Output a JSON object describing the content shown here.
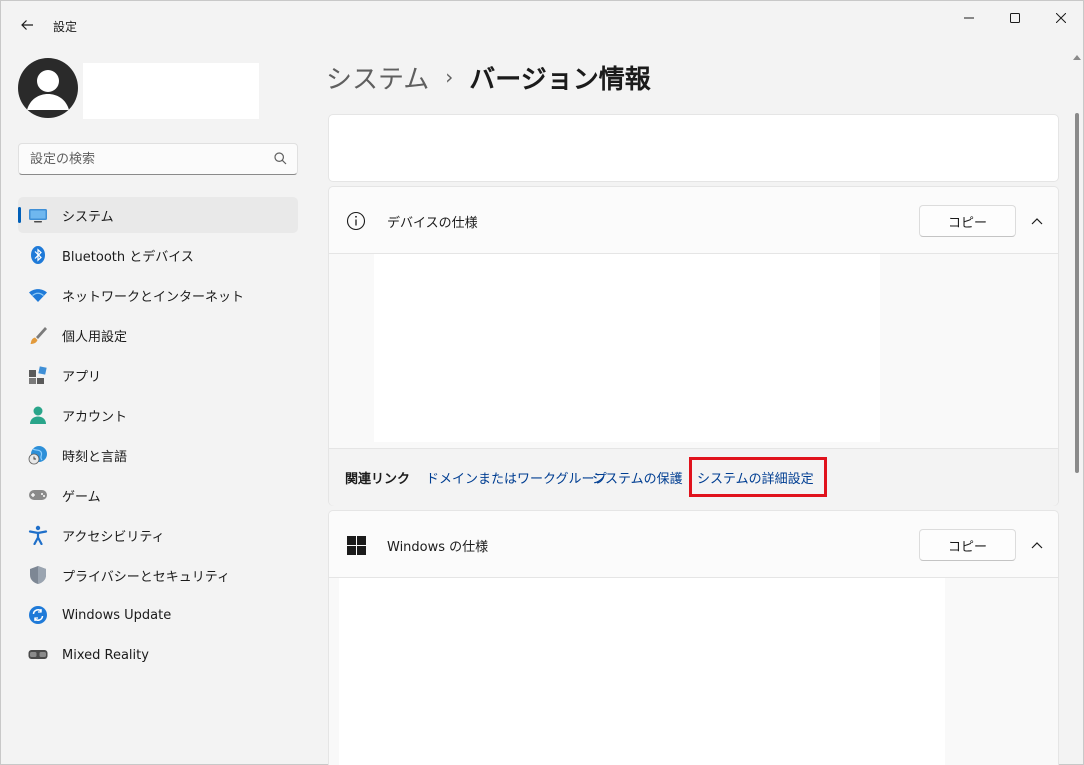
{
  "window": {
    "app_title": "設定"
  },
  "sidebar": {
    "search_placeholder": "設定の検索",
    "items": [
      {
        "label": "システム",
        "icon": "system-icon",
        "selected": true
      },
      {
        "label": "Bluetooth とデバイス",
        "icon": "bluetooth-icon"
      },
      {
        "label": "ネットワークとインターネット",
        "icon": "wifi-icon"
      },
      {
        "label": "個人用設定",
        "icon": "brush-icon"
      },
      {
        "label": "アプリ",
        "icon": "apps-icon"
      },
      {
        "label": "アカウント",
        "icon": "account-icon"
      },
      {
        "label": "時刻と言語",
        "icon": "globe-clock-icon"
      },
      {
        "label": "ゲーム",
        "icon": "gamepad-icon"
      },
      {
        "label": "アクセシビリティ",
        "icon": "accessibility-icon"
      },
      {
        "label": "プライバシーとセキュリティ",
        "icon": "shield-icon"
      },
      {
        "label": "Windows Update",
        "icon": "update-icon"
      },
      {
        "label": "Mixed Reality",
        "icon": "headset-icon"
      }
    ]
  },
  "breadcrumb": {
    "parent": "システム",
    "separator": "›",
    "current": "バージョン情報"
  },
  "device_spec": {
    "title": "デバイスの仕様",
    "copy_label": "コピー"
  },
  "related_links": {
    "title": "関連リンク",
    "links": [
      "ドメインまたはワークグループ",
      "システムの保護",
      "システムの詳細設定"
    ]
  },
  "windows_spec": {
    "title": "Windows の仕様",
    "copy_label": "コピー"
  },
  "colors": {
    "accent": "#005fb8",
    "link": "#003e92",
    "highlight": "#e0121c"
  }
}
